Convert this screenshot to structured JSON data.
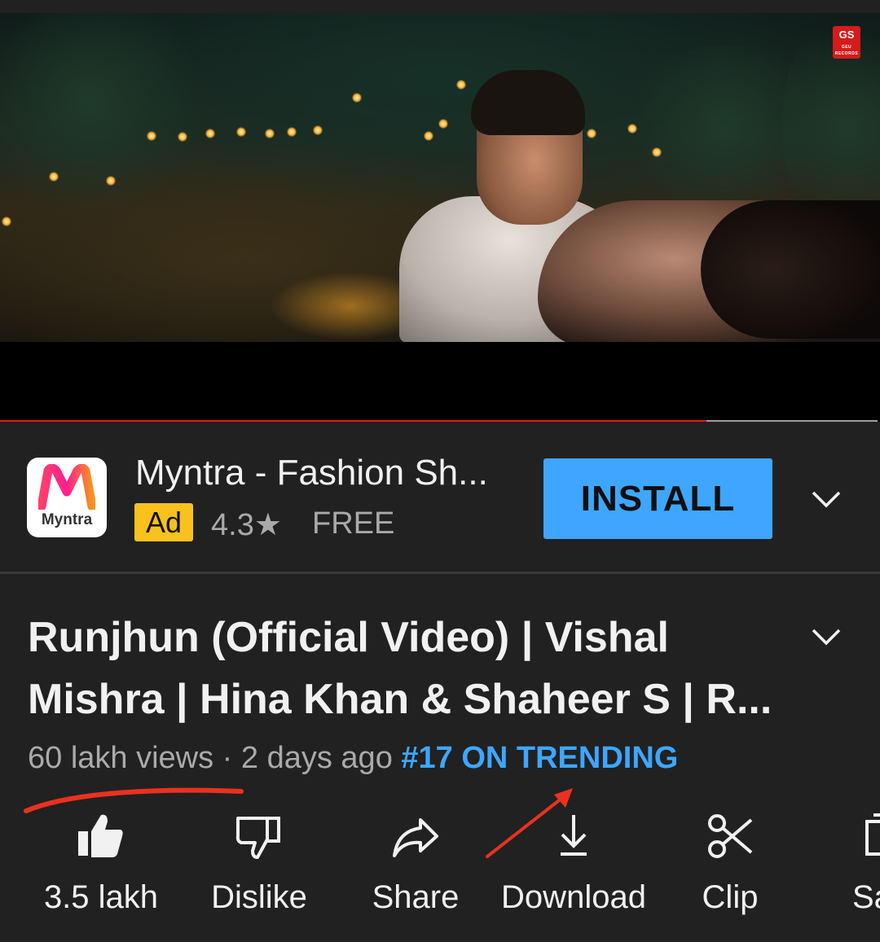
{
  "player": {
    "progress_fraction": 0.805,
    "channel_logo_text": "GS",
    "channel_logo_subtext": "GEU RECORDS"
  },
  "ad": {
    "icon_label": "Myntra",
    "title": "Myntra - Fashion Sh...",
    "badge": "Ad",
    "rating": "4.3★",
    "price": "FREE",
    "install_label": "INSTALL"
  },
  "video": {
    "title": "Runjhun (Official Video) | Vishal Mishra | Hina Khan & Shaheer S | R...",
    "views": "60 lakh views",
    "separator": " · ",
    "age": "2 days ago",
    "trending": "#17 ON TRENDING"
  },
  "actions": [
    {
      "label": "3.5 lakh",
      "icon": "thumbs-up-icon"
    },
    {
      "label": "Dislike",
      "icon": "thumbs-down-icon"
    },
    {
      "label": "Share",
      "icon": "share-icon"
    },
    {
      "label": "Download",
      "icon": "download-icon"
    },
    {
      "label": "Clip",
      "icon": "scissors-icon"
    },
    {
      "label": "Sa",
      "icon": "save-icon"
    }
  ],
  "colors": {
    "background": "#212121",
    "accent_blue": "#3ea6ff",
    "progress_red": "#e21b1b",
    "ad_badge_yellow": "#f9c11d",
    "annotation_red": "#e8321f"
  }
}
